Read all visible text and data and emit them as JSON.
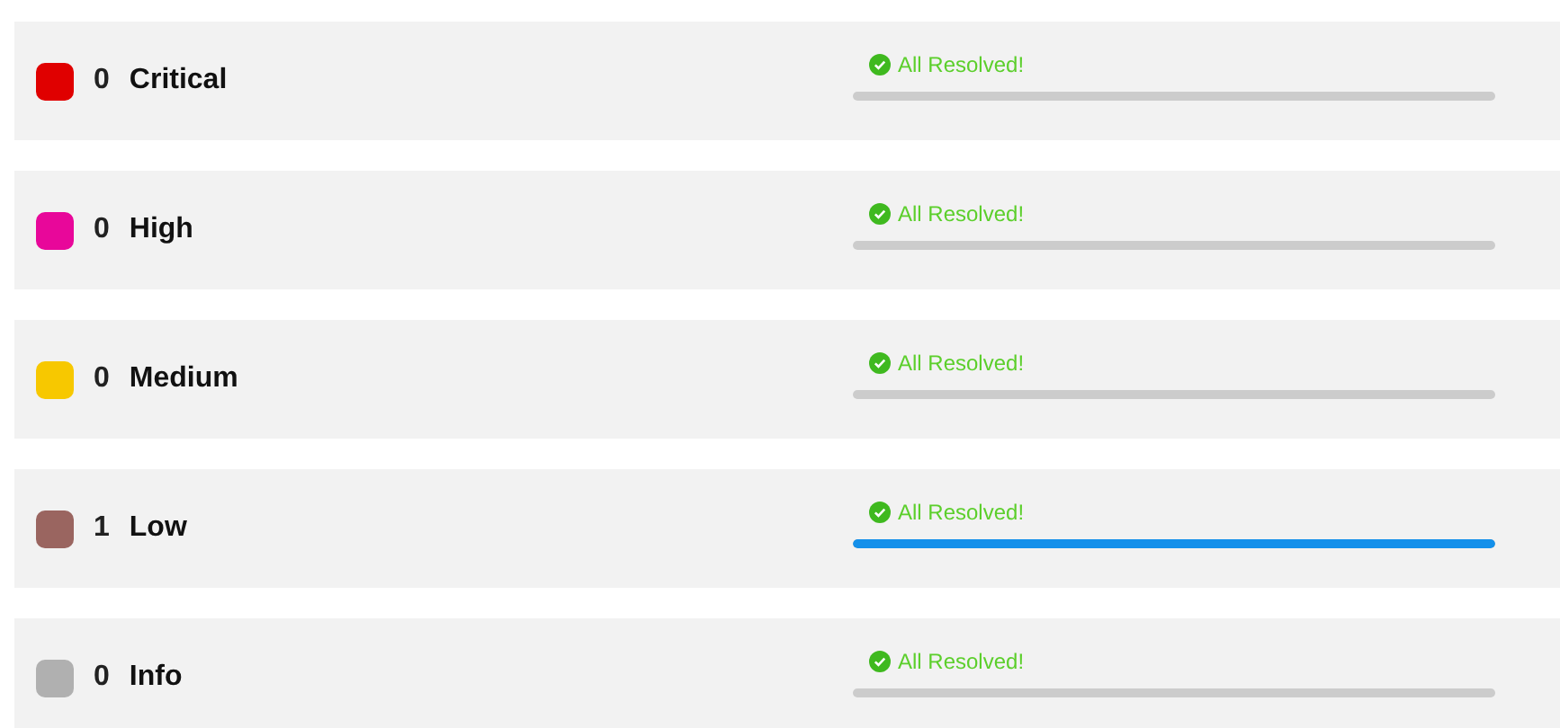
{
  "severities": [
    {
      "count": "0",
      "label": "Critical",
      "color": "#e00000",
      "status": "All Resolved!",
      "level": 0
    },
    {
      "count": "0",
      "label": "High",
      "color": "#e8079a",
      "status": "All Resolved!",
      "level": 0
    },
    {
      "count": "0",
      "label": "Medium",
      "color": "#f7c800",
      "status": "All Resolved!",
      "level": 0
    },
    {
      "count": "1",
      "label": "Low",
      "color": "#9a6560",
      "status": "All Resolved!",
      "level": 1
    },
    {
      "count": "0",
      "label": "Info",
      "color": "#b0b0b0",
      "status": "All Resolved!",
      "level": 0
    }
  ]
}
